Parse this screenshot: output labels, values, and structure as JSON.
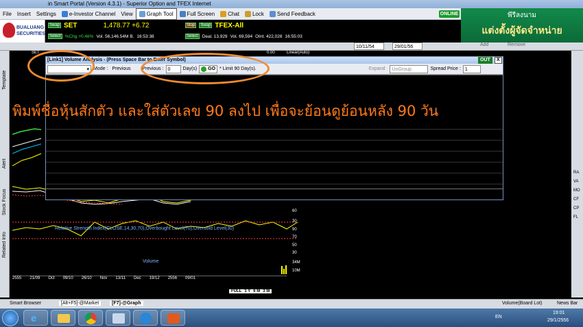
{
  "window": {
    "title": "in Smart Portal (Version 4.3.1) - Superior Option and TFEX Internet"
  },
  "menu": {
    "items": [
      {
        "label": "File"
      },
      {
        "label": "Insert"
      },
      {
        "label": "Settings"
      },
      {
        "label": "e-Investor Channel"
      },
      {
        "label": "View"
      },
      {
        "label": "Graph Tool"
      },
      {
        "label": "Full Screen"
      },
      {
        "label": "Chat"
      },
      {
        "label": "Lock"
      },
      {
        "label": "Send Feedback"
      }
    ],
    "online": "ONLINE"
  },
  "logo": {
    "line1": "BUALUANG",
    "line2": "SECURITIES"
  },
  "quote_set": {
    "swap": "Swap",
    "select": "Select",
    "symbol": "SET",
    "value": "1,478.77 +6.72",
    "chg": "%Chg.+0.46%",
    "vol": "Vol. 56,146.54M B.",
    "time": "16:53:38"
  },
  "quote_tfex": {
    "swap": "Swap",
    "select": "Select",
    "stop": "Stop",
    "symbol": "TFEX-All",
    "deal": "Deal. 13,929",
    "vol": "Vol. 69,594",
    "oint": "OInt. 422,028",
    "time": "16:55:03"
  },
  "banner": {
    "line1": "พีรีลงนาม",
    "line2": "แต่งตั้งผู้จัดจำหน่าย"
  },
  "toolbar": {
    "date_from": "10/11/54",
    "date_to": "29/01/56",
    "add": "Add",
    "remove": "Remove"
  },
  "chart": {
    "set_label": "SET",
    "val": "0.00",
    "scale": "Linear(Auto)",
    "rsi_title": "Relative Strength Index(CLOSE,14,30,70),Overbought Level(70),Oversold Level(30)",
    "rsi_ticks": [
      "60",
      "30",
      "90",
      "70",
      "50",
      "30"
    ],
    "volume_title": "Volume",
    "vol_ticks": [
      "34M",
      "10M"
    ],
    "xaxis": [
      "2555",
      "21/09",
      "Oct",
      "09/10",
      "26/10",
      "Nov",
      "13/11",
      "Dec",
      "19/12",
      "2556",
      "09/01"
    ],
    "periods": [
      "FULL",
      "1 Y",
      "6 M",
      "3 M"
    ]
  },
  "left_tabs": [
    "Template",
    "Alert",
    "Stock Focus",
    "Related Info"
  ],
  "right_tools": [
    "RA",
    "VA",
    "MO",
    "CF",
    "CP",
    "FL"
  ],
  "dialog": {
    "title": "[Link1] Volume Analysis - (Press Space Bar to Enter Symbol)",
    "out": "OUT",
    "close": "X",
    "mode_label": "Mode :",
    "mode_value": "Previous",
    "previous_label": "Previous :",
    "previous_value": "0",
    "days_label": "Day(s)",
    "go": "GO",
    "limit": "* Limit 90 Day(s).",
    "expand": "Expand",
    "ungroup": "UnGroup",
    "spread_label": "Spread Price :",
    "spread_value": "1"
  },
  "annotation": "พิมพ์ชื่อหุ้นสักตัว และใส่ตัวเลข 90 ลงไป เพื่อจะย้อนดูย้อนหลัง 90 วัน",
  "statusbar": {
    "smart_browser": "Smart Browser",
    "market": "[Alt+F5]-@Market",
    "egraph": "[F7]-@Graph",
    "volume": "Volume(Board Lot)",
    "news": "News Bar"
  },
  "taskbar": {
    "lang": "EN",
    "time": "19:01",
    "date": "29/1/2556"
  },
  "colors": {
    "accent_orange": "#f08a30",
    "online_green": "#1f9b2f",
    "quote_yellow": "#ffff00"
  }
}
